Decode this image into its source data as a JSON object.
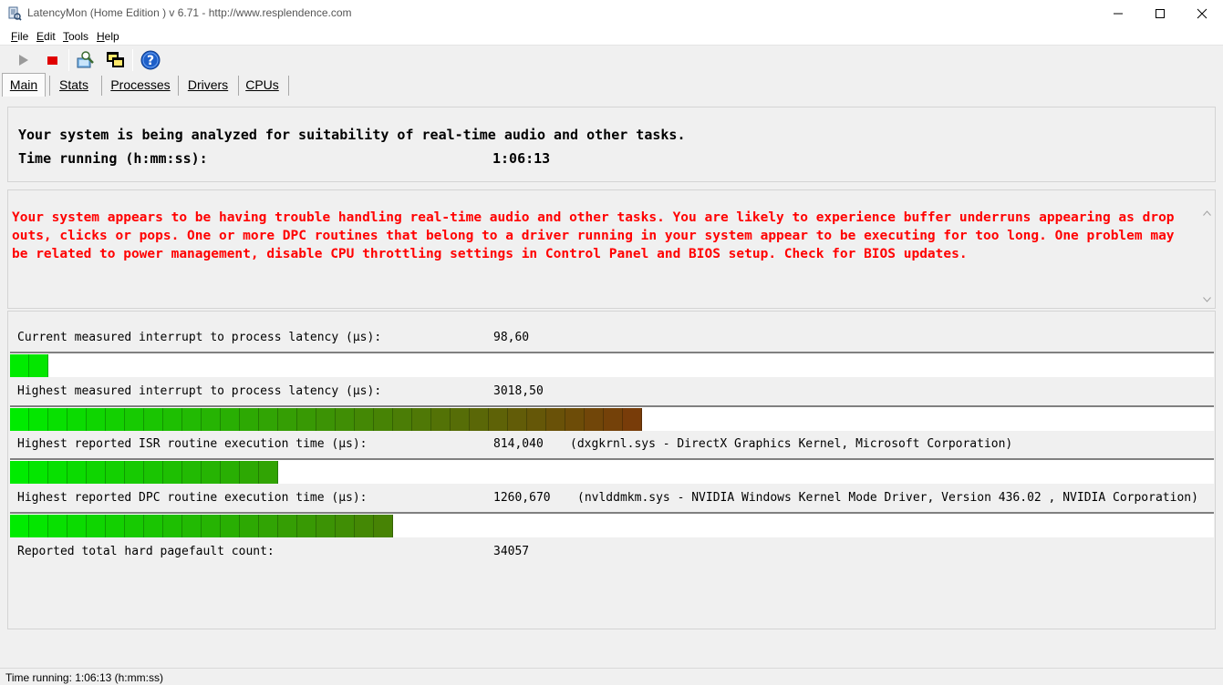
{
  "window": {
    "title": "LatencyMon  (Home Edition )  v 6.71 - http://www.resplendence.com"
  },
  "menu": [
    {
      "label": "File",
      "accel": "F",
      "rest": "ile"
    },
    {
      "label": "Edit",
      "accel": "E",
      "rest": "dit"
    },
    {
      "label": "Tools",
      "accel": "T",
      "rest": "ools"
    },
    {
      "label": "Help",
      "accel": "H",
      "rest": "elp"
    }
  ],
  "toolbar": {
    "icons": [
      "play-icon",
      "stop-icon",
      "analyze-icon",
      "windows-icon",
      "help-icon"
    ],
    "colors": {
      "play": "#9a9a9a",
      "stop": "#e00000",
      "help": "#1e5fc8"
    }
  },
  "tabs": [
    {
      "label": "Main",
      "active": true
    },
    {
      "label": "Stats",
      "active": false
    },
    {
      "label": "Processes",
      "active": false
    },
    {
      "label": "Drivers",
      "active": false
    },
    {
      "label": "CPUs",
      "active": false
    }
  ],
  "summary": {
    "line1": "Your system is being analyzed for suitability of real-time audio and other tasks.",
    "time_label": "Time running (h:mm:ss):",
    "time_value": "1:06:13"
  },
  "warning": {
    "text": "Your system appears to be having trouble handling real-time audio and other tasks. You are likely to experience buffer underruns appearing as drop outs, clicks or pops. One or more DPC routines that belong to a driver running in your system appear to be executing for too long. One problem may be related to power management, disable CPU throttling settings in Control Panel and BIOS setup. Check for BIOS updates.",
    "color": "#ff0000"
  },
  "metrics": [
    {
      "label": "Current measured interrupt to process latency (µs):",
      "value": "98,60",
      "extra": "",
      "segments": 2
    },
    {
      "label": "Highest measured interrupt to process latency (µs):",
      "value": "3018,50",
      "extra": "",
      "segments": 33
    },
    {
      "label": "Highest reported ISR routine execution time (µs):",
      "value": "814,040",
      "extra": "(dxgkrnl.sys - DirectX Graphics Kernel, Microsoft Corporation)",
      "segments": 14
    },
    {
      "label": "Highest reported DPC routine execution time (µs):",
      "value": "1260,670",
      "extra": "(nvlddmkm.sys - NVIDIA Windows Kernel Mode Driver, Version 436.02 , NVIDIA Corporation)",
      "segments": 20
    },
    {
      "label": "Reported total hard pagefault count:",
      "value": "34057",
      "extra": "",
      "segments": 0
    }
  ],
  "status": {
    "text": "Time running: 1:06:13  (h:mm:ss)"
  }
}
